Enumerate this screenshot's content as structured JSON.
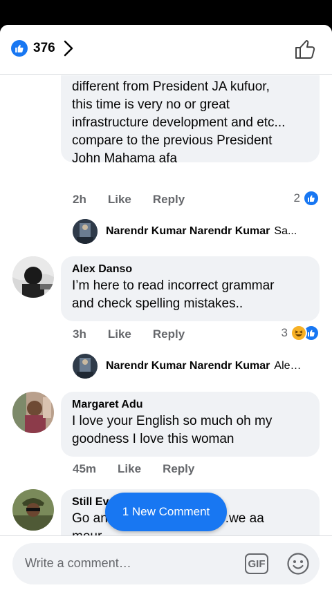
{
  "header": {
    "reaction_count": "376"
  },
  "comments": [
    {
      "author": "",
      "text_lines": [
        "different from President JA kufuor,",
        "this time is very no or great",
        "infrastructure development and etc...",
        "compare to the previous President",
        "John Mahama afa"
      ],
      "time": "2h",
      "like_label": "Like",
      "reply_label": "Reply",
      "reaction_count": "2",
      "reply_preview": {
        "name": "Narendr Kumar Narendr Kumar",
        "text": "Sa..."
      }
    },
    {
      "author": "Alex Danso",
      "text_lines": [
        "I’m here to read incorrect grammar",
        "and check spelling mistakes.."
      ],
      "time": "3h",
      "like_label": "Like",
      "reply_label": "Reply",
      "reaction_count": "3",
      "reply_preview": {
        "name": "Narendr Kumar Narendr Kumar",
        "text": "Alex..."
      }
    },
    {
      "author": "Margaret Adu",
      "text_lines": [
        "I love your English so much oh my",
        "goodness I love this woman"
      ],
      "time": "45m",
      "like_label": "Like",
      "reply_label": "Reply"
    },
    {
      "author": "Still Evelyn Barbie Reigns",
      "text_lines": [
        "Go and sleep somewhere..we aa",
        "mour"
      ]
    }
  ],
  "new_comment_pill": "1 New Comment",
  "composer": {
    "placeholder": "Write a comment…",
    "gif_label": "GIF"
  },
  "colors": {
    "accent": "#1877f2",
    "bubble": "#f0f2f5",
    "secondary_text": "#65676b"
  }
}
